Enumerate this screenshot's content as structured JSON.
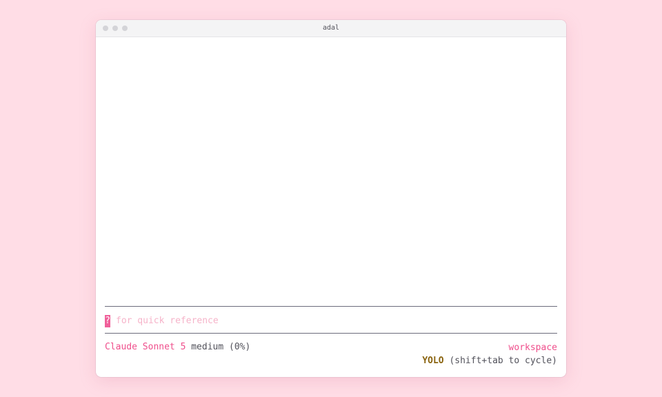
{
  "window": {
    "title": "adal"
  },
  "prompt": {
    "cursor_char": "?",
    "hint": "for quick reference"
  },
  "status": {
    "model": "Claude Sonnet 5",
    "effort": "medium (0%)",
    "workspace": "workspace",
    "mode": "YOLO",
    "mode_hint": "(shift+tab to cycle)"
  },
  "colors": {
    "background": "#ffdde6",
    "accent": "#ef4f8c",
    "mode": "#8a6410",
    "hint": "#f6b3c9"
  }
}
